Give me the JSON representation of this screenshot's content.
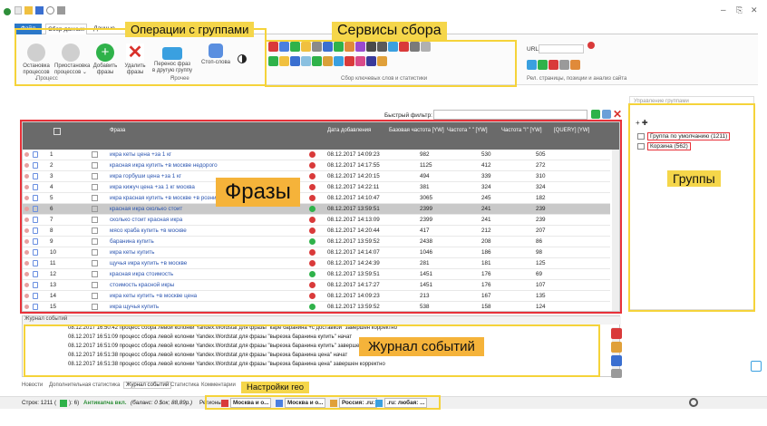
{
  "titlebar": {
    "controls": [
      "–",
      "⎘",
      "✕"
    ]
  },
  "tabs": [
    {
      "label": "Файл"
    },
    {
      "label": "Сбор данных"
    },
    {
      "label": "Данные"
    }
  ],
  "ribbon": {
    "group_ops": {
      "buttons": [
        {
          "label": "Остановка процессов ⌄",
          "icon": "stop-icon",
          "color": "#c9c9c9"
        },
        {
          "label": "Приостановка процессов ⌄",
          "icon": "pause-icon",
          "color": "#c9c9c9"
        },
        {
          "label": "Добавить фразы",
          "icon": "add-icon",
          "color": "#2fb24a"
        },
        {
          "label": "Удалить фразы",
          "icon": "delete-icon",
          "color": "#d9312b"
        },
        {
          "label": "Перенос фраз в другую группу ⌄",
          "icon": "move-icon",
          "color": "#3aa0e0"
        },
        {
          "label": "Стоп-слова",
          "icon": "shield-icon",
          "color": "#3a7fd8"
        }
      ],
      "section_labels": [
        "Процесс",
        "Прочее"
      ]
    },
    "collection": {
      "section_label": "Сбор ключевых слов и статистики"
    },
    "url": {
      "label": "URL:",
      "section_label": "Рел. страницы, позиции и анализ сайта"
    }
  },
  "annotations": {
    "group_ops": "Операции с группами",
    "collection": "Сервисы сбора",
    "phrases": "Фразы",
    "groups": "Группы",
    "log": "Журнал событий",
    "geo": "Настройки гео"
  },
  "grid": {
    "quick_filter_label": "Быстрый фильтр:",
    "columns": [
      "Фраза",
      "Дата добавления",
      "Базовая частота [YW]",
      "Частота \" \" [YW]",
      "Частота \"!\" [YW]",
      "[QUERY] [YW]"
    ],
    "rows": [
      {
        "n": "1",
        "phrase": "икра кеты цена +за 1 кг",
        "date": "08.12.2017 14:09:23",
        "base": "982",
        "q": "530",
        "ex": "505",
        "src": "ya"
      },
      {
        "n": "2",
        "phrase": "красная икра купить +в москве недорого",
        "date": "08.12.2017 14:17:55",
        "base": "1125",
        "q": "412",
        "ex": "272",
        "src": "ya"
      },
      {
        "n": "3",
        "phrase": "икра горбуши цена +за 1 кг",
        "date": "08.12.2017 14:20:15",
        "base": "494",
        "q": "339",
        "ex": "310",
        "src": "ya"
      },
      {
        "n": "4",
        "phrase": "икра кижуч цена +за 1 кг москва",
        "date": "08.12.2017 14:22:11",
        "base": "381",
        "q": "324",
        "ex": "324",
        "src": "ya"
      },
      {
        "n": "5",
        "phrase": "икра красная купить +в москве +в розницу",
        "date": "08.12.2017 14:10:47",
        "base": "3065",
        "q": "245",
        "ex": "182",
        "src": "ya"
      },
      {
        "n": "6",
        "phrase": "красная икра сколько стоит",
        "date": "08.12.2017 13:59:51",
        "base": "2399",
        "q": "241",
        "ex": "239",
        "src": "g"
      },
      {
        "n": "7",
        "phrase": "сколько стоит красная икра",
        "date": "08.12.2017 14:13:09",
        "base": "2399",
        "q": "241",
        "ex": "239",
        "src": "ya"
      },
      {
        "n": "8",
        "phrase": "мясо краба купить +в москве",
        "date": "08.12.2017 14:20:44",
        "base": "417",
        "q": "212",
        "ex": "207",
        "src": "ya"
      },
      {
        "n": "9",
        "phrase": "баранина купить",
        "date": "08.12.2017 13:59:52",
        "base": "2438",
        "q": "208",
        "ex": "86",
        "src": "g"
      },
      {
        "n": "10",
        "phrase": "икра кеты купить",
        "date": "08.12.2017 14:14:07",
        "base": "1046",
        "q": "186",
        "ex": "98",
        "src": "ya"
      },
      {
        "n": "11",
        "phrase": "щучья икра купить +в москве",
        "date": "08.12.2017 14:24:39",
        "base": "281",
        "q": "181",
        "ex": "125",
        "src": "ya"
      },
      {
        "n": "12",
        "phrase": "красная икра стоимость",
        "date": "08.12.2017 13:59:51",
        "base": "1451",
        "q": "176",
        "ex": "69",
        "src": "g"
      },
      {
        "n": "13",
        "phrase": "стоимость красной икры",
        "date": "08.12.2017 14:17:27",
        "base": "1451",
        "q": "176",
        "ex": "107",
        "src": "ya"
      },
      {
        "n": "14",
        "phrase": "икра кеты купить +в москве цена",
        "date": "08.12.2017 14:09:23",
        "base": "213",
        "q": "167",
        "ex": "135",
        "src": "ya"
      },
      {
        "n": "15",
        "phrase": "икра щучья купить",
        "date": "08.12.2017 13:59:52",
        "base": "538",
        "q": "158",
        "ex": "124",
        "src": "g"
      },
      {
        "n": "16",
        "phrase": "щучья икра купить",
        "date": "08.12.2017 14:24:39",
        "base": "538",
        "q": "158",
        "ex": "124",
        "src": "ya"
      },
      {
        "n": "17",
        "phrase": "икра кеты цена",
        "date": "08.12.2017 14:09:23",
        "base": "2097",
        "q": "156",
        "ex": "132",
        "src": "ya"
      }
    ]
  },
  "groups_panel": {
    "title": "Управление группами",
    "items": [
      {
        "label": "Группа по умолчанию (1211)"
      },
      {
        "label": "Корзина (562)"
      }
    ]
  },
  "log": {
    "title": "Журнал событий",
    "lines": [
      "08.12.2017 16:50:42  процесс сбора левой колонки Yandex.Wordstat для фразы \"каре баранина +с доставкой\" завершен корректно",
      "08.12.2017 16:51:09  процесс сбора левой колонки Yandex.Wordstat для фразы \"вырезка баранина купить\" начат",
      "08.12.2017 16:51:09  процесс сбора левой колонки Yandex.Wordstat для фразы \"вырезка баранина купить\" завершен ко",
      "08.12.2017 16:51:38  процесс сбора левой колонки Yandex.Wordstat для фразы \"вырезка баранина цена\" начат",
      "08.12.2017 16:51:38  процесс сбора левой колонки Yandex.Wordstat для фразы \"вырезка баранина цена\" завершен корректно"
    ]
  },
  "bottom_tabs": [
    {
      "label": "Новости"
    },
    {
      "label": "Дополнительная статистика"
    },
    {
      "label": "Журнал событий"
    },
    {
      "label": "Статистика"
    },
    {
      "label": "Комментарии"
    }
  ],
  "status": {
    "rows": "Строк: 1211 (",
    "rows_selected": "): 6)",
    "captcha": "Антикапча вкл.",
    "balance": "(баланс: 0 $ок; 88,89р.)",
    "regions_label": "Регионы:",
    "region1": "Москва и о...",
    "region2": "Москва и о...",
    "region3": "Россия: .ru:",
    "region4": ".ru: любая: ..."
  }
}
